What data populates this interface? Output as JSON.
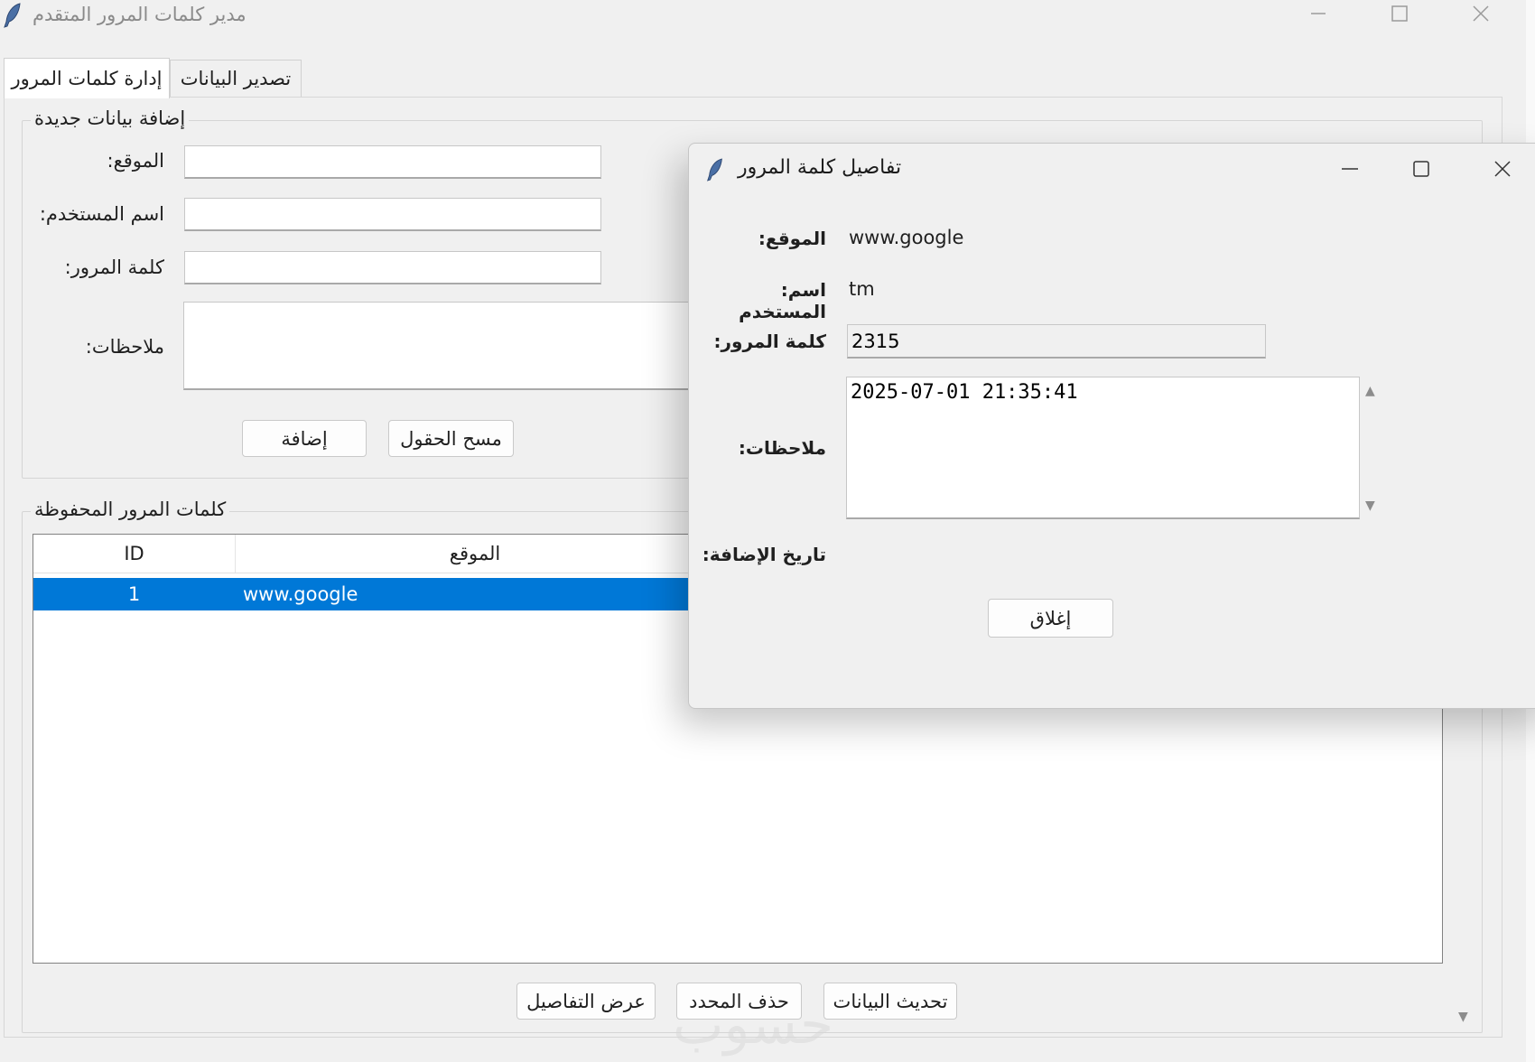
{
  "window": {
    "title": "مدير كلمات المرور المتقدم"
  },
  "tabs": [
    {
      "label": "إدارة كلمات المرور",
      "active": true
    },
    {
      "label": "تصدير البيانات",
      "active": false
    }
  ],
  "add_group": {
    "title": "إضافة بيانات جديدة",
    "site_label": ":الموقع",
    "username_label": ":اسم المستخدم",
    "password_label": ":كلمة المرور",
    "notes_label": ":ملاحظات",
    "site_value": "",
    "username_value": "",
    "password_value": "",
    "notes_value": "",
    "add_button": "إضافة",
    "clear_button": "مسح الحقول"
  },
  "saved_group": {
    "title": "كلمات المرور المحفوظة",
    "columns": [
      "ID",
      "الموقع"
    ],
    "rows": [
      {
        "id": "1",
        "site": "www.google",
        "selected": true
      }
    ],
    "refresh_button": "تحديث البيانات",
    "delete_button": "حذف المحدد",
    "details_button": "عرض التفاصيل"
  },
  "dialog": {
    "title": "تفاصيل كلمة المرور",
    "site_label": ":الموقع",
    "site_value": "www.google",
    "username_label": ":اسم المستخدم",
    "username_value": "tm",
    "password_label": ":كلمة المرور",
    "password_value": "2315",
    "notes_label": ":ملاحظات",
    "notes_value": "2025-07-01 21:35:41",
    "date_label": ":تاريخ الإضافة",
    "date_value": "",
    "close_button": "إغلاق"
  },
  "watermark": "حسوب",
  "colors": {
    "selection": "#0078d7",
    "window_bg": "#f0f0f0"
  },
  "icons": [
    "feather-icon",
    "minimize-icon",
    "maximize-icon",
    "close-icon",
    "scroll-up-icon",
    "scroll-down-icon"
  ]
}
